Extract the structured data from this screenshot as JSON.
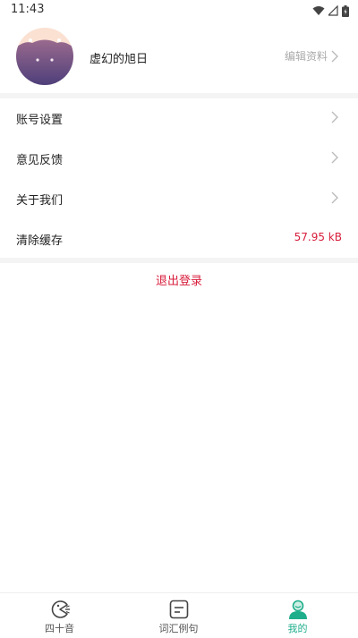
{
  "status_bar": {
    "time": "11:43"
  },
  "profile": {
    "username": "虚幻的旭日",
    "edit_label": "编辑资料"
  },
  "menu": {
    "items": [
      {
        "label": "账号设置"
      },
      {
        "label": "意见反馈"
      },
      {
        "label": "关于我们"
      },
      {
        "label": "清除缓存",
        "value": "57.95 kB"
      }
    ]
  },
  "logout_label": "退出登录",
  "tabs": [
    {
      "label": "四十音",
      "icon": "pacman-icon"
    },
    {
      "label": "词汇例句",
      "icon": "notebook-icon"
    },
    {
      "label": "我的",
      "icon": "user-icon",
      "active": true
    }
  ],
  "colors": {
    "accent_red": "#d81e3c",
    "active_tab": "#1fae8c",
    "secondary_text": "#aaaaaa"
  }
}
